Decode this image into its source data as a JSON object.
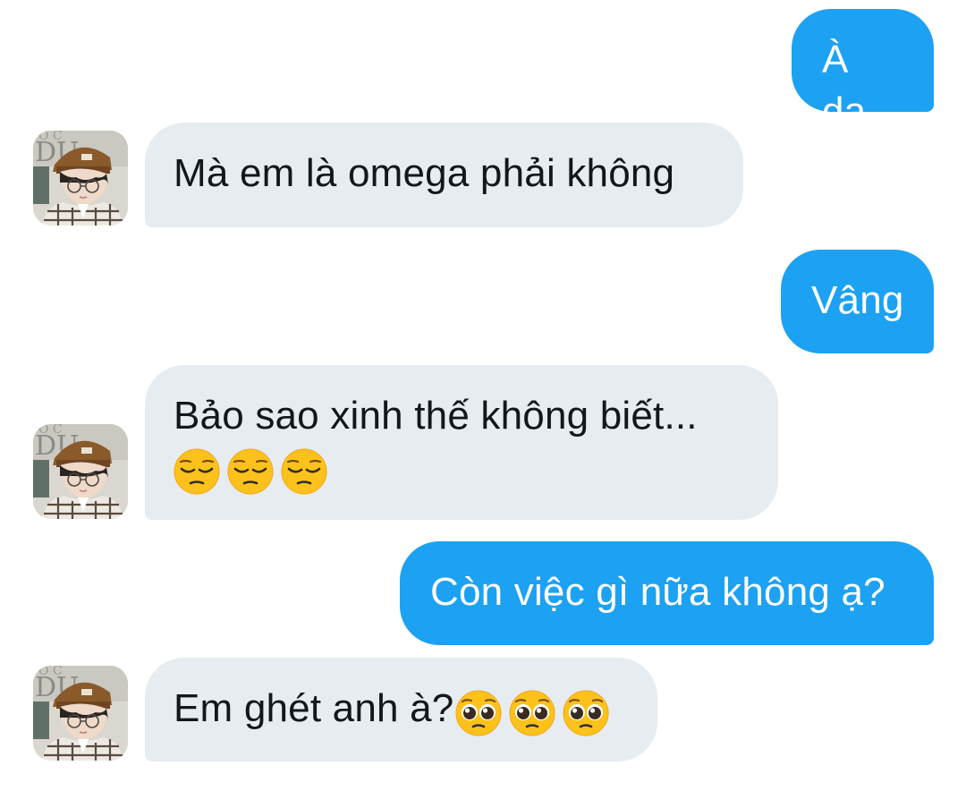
{
  "messages": [
    {
      "id": "m1",
      "direction": "outgoing",
      "text": "À dạ"
    },
    {
      "id": "m2",
      "direction": "incoming",
      "text": "Mà em là omega phải không"
    },
    {
      "id": "m3",
      "direction": "outgoing",
      "text": "Vâng"
    },
    {
      "id": "m4",
      "direction": "incoming",
      "text": "Bảo sao xinh thế không biết...",
      "emojis": [
        "pensive-face",
        "pensive-face",
        "pensive-face"
      ]
    },
    {
      "id": "m5",
      "direction": "outgoing",
      "text": "Còn việc gì nữa không ạ?"
    },
    {
      "id": "m6",
      "direction": "incoming",
      "text": "Em ghét anh à?",
      "emojis": [
        "pleading-face",
        "pleading-face",
        "pleading-face"
      ]
    }
  ],
  "colors": {
    "outgoing_bubble": "#1da1f2",
    "incoming_bubble": "#e6ecf0",
    "incoming_text": "#14171a",
    "outgoing_text": "#ffffff",
    "background": "#ffffff"
  }
}
